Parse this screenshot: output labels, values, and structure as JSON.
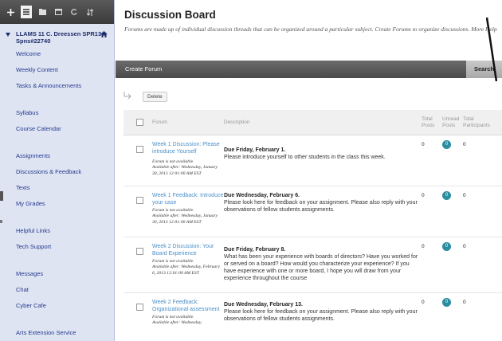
{
  "sidebar": {
    "course_title": "LLAMS 11 C. Dreessen SPR13 Spns#22740",
    "items": [
      {
        "label": "Welcome"
      },
      {
        "label": "Weekly Content"
      },
      {
        "label": "Tasks & Announcements"
      },
      {
        "label": "Syllabus"
      },
      {
        "label": "Course Calendar"
      },
      {
        "label": "Assignments"
      },
      {
        "label": "Discussions & Feedback"
      },
      {
        "label": "Texts"
      },
      {
        "label": "My Grades"
      },
      {
        "label": "Helpful Links"
      },
      {
        "label": "Tech Support"
      },
      {
        "label": "Messages"
      },
      {
        "label": "Chat"
      },
      {
        "label": "Cyber Cafe"
      },
      {
        "label": "Arts Extension Service"
      }
    ]
  },
  "page": {
    "title": "Discussion Board",
    "description": "Forums are made up of individual discussion threads that can be organized around a particular subject. Create Forums to organize discussions.",
    "more_help": "More Help"
  },
  "toolbar": {
    "create_forum": "Create Forum",
    "search": "Search",
    "delete": "Delete"
  },
  "table": {
    "headers": {
      "forum": "Forum",
      "description": "Description",
      "total_posts": "Total Posts",
      "unread_posts": "Unread Posts",
      "total_participants": "Total Participants"
    },
    "rows": [
      {
        "forum": "Week 1 Discussion: Please introduce Yourself",
        "status": "Forum is not available.",
        "availability": "Available after: Wednesday, January 30, 2013 12:01:00 AM EST",
        "due": "Due Friday, February 1.",
        "text": "Please introduce yourself to other students in the class this week.",
        "total": "0",
        "unread": "0",
        "participants": "0"
      },
      {
        "forum": "Week 1 Feedback: Introduce your case",
        "status": "Forum is not available.",
        "availability": "Available after: Wednesday, January 30, 2013 12:01:00 AM EST",
        "due": "Due Wednesday, February 6.",
        "text": "Please look here for feedback on your assignment. Please also reply with your observations of fellow students assignments.",
        "total": "0",
        "unread": "0",
        "participants": "0"
      },
      {
        "forum": "Week 2 Discussion: Your Board Experience",
        "status": "Forum is not available.",
        "availability": "Available after: Wednesday, February 6, 2013 12:01:00 AM EST",
        "due": "Due Friday, February 8.",
        "text": "What has been your experience with boards of directors? Have you worked for or served on a board? How would you characterize your experience? If you have experience with one or more board, I hope you will draw from your experience throughout the course",
        "total": "0",
        "unread": "0",
        "participants": "0"
      },
      {
        "forum": "Week 2 Feedback: Organizational assessment",
        "status": "Forum is not available.",
        "availability": "Available after: Wednesday,",
        "due": "Due Wednesday, February 13.",
        "text": "Please look here for feedback on your assignment. Please also reply with your observations of fellow students assignments.",
        "total": "0",
        "unread": "0",
        "participants": "0"
      }
    ]
  },
  "colors": {
    "sidebar_bg": "#dfe4f2",
    "link": "#4a8fc9",
    "unread_badge": "#2c8ca0",
    "action_bar": "#555555"
  }
}
